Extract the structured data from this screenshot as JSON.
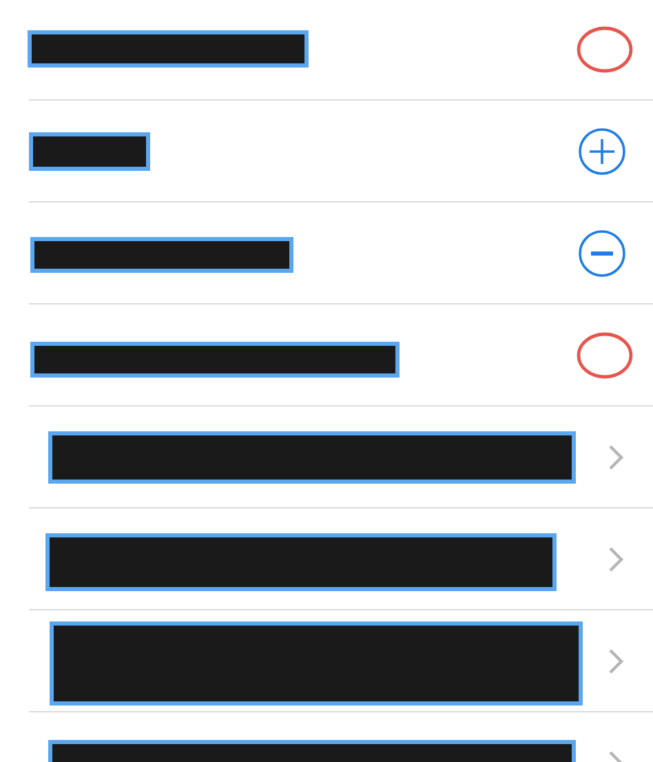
{
  "rows": [
    {
      "kind": "circle"
    },
    {
      "kind": "add"
    },
    {
      "kind": "remove"
    },
    {
      "kind": "circle"
    },
    {
      "kind": "link"
    },
    {
      "kind": "link"
    },
    {
      "kind": "link"
    },
    {
      "kind": "link"
    }
  ]
}
